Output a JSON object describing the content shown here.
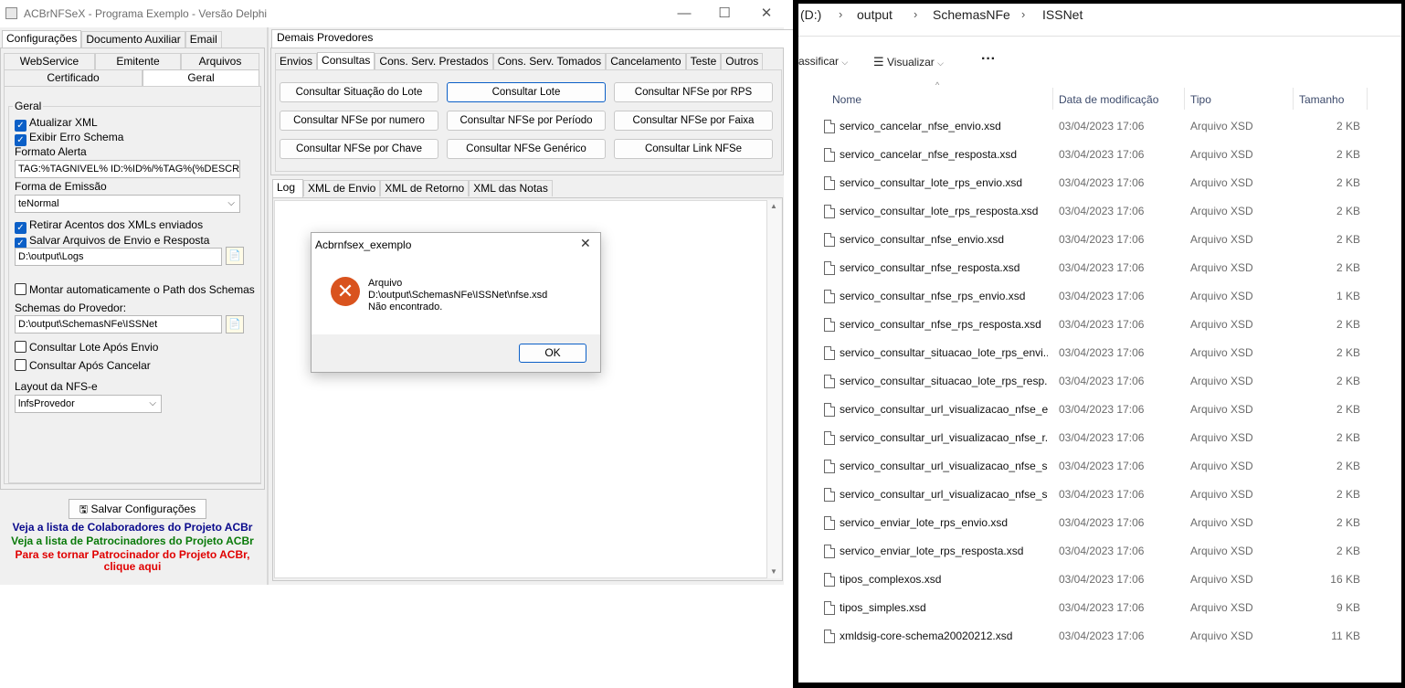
{
  "app": {
    "title": "ACBrNFSeX - Programa Exemplo - Versão Delphi",
    "window_controls": {
      "minimize": "—",
      "maximize": "☐",
      "close": "✕"
    },
    "left_tabs": [
      "Configurações",
      "Documento Auxiliar",
      "Email"
    ],
    "sub_tabs_row1": [
      "WebService",
      "Emitente",
      "Arquivos"
    ],
    "sub_tabs_row2": [
      "Certificado",
      "Geral"
    ],
    "geral": {
      "group_label": "Geral",
      "atualizar_xml": "Atualizar XML",
      "exibir_erro": "Exibir Erro Schema",
      "formato_alerta_label": "Formato Alerta",
      "formato_alerta_value": "TAG:%TAGNIVEL% ID:%ID%/%TAG%(%DESCRI",
      "forma_emissao_label": "Forma de Emissão",
      "forma_emissao_value": "teNormal",
      "retirar_acentos": "Retirar Acentos dos XMLs enviados",
      "salvar_arquivos": "Salvar Arquivos de Envio e Resposta",
      "logs_path": "D:\\output\\Logs",
      "montar_path": "Montar automaticamente o Path dos Schemas",
      "schemas_label": "Schemas do Provedor:",
      "schemas_path": "D:\\output\\SchemasNFe\\ISSNet",
      "consultar_lote": "Consultar Lote Após Envio",
      "consultar_cancelar": "Consultar Após Cancelar",
      "layout_label": "Layout da NFS-e",
      "layout_value": "lnfsProvedor"
    },
    "salvar_button": "Salvar Configurações",
    "links": {
      "colaboradores": "Veja a lista de Colaboradores do Projeto ACBr",
      "patrocinadores": "Veja a lista de Patrocinadores do Projeto ACBr",
      "patrocinador_line1": "Para se tornar Patrocinador do Projeto ACBr,",
      "patrocinador_line2": "clique aqui"
    },
    "right_top_tab": "Demais Provedores",
    "op_tabs": [
      "Envios",
      "Consultas",
      "Cons. Serv. Prestados",
      "Cons. Serv. Tomados",
      "Cancelamento",
      "Teste",
      "Outros"
    ],
    "consulta_buttons": [
      [
        "Consultar Situação do Lote",
        "Consultar Lote",
        "Consultar NFSe por RPS"
      ],
      [
        "Consultar NFSe por numero",
        "Consultar NFSe por Período",
        "Consultar NFSe por Faixa"
      ],
      [
        "Consultar NFSe por Chave",
        "Consultar NFSe Genérico",
        "Consultar Link NFSe"
      ]
    ],
    "log_tabs": [
      "Log",
      "XML de Envio",
      "XML de Retorno",
      "XML das Notas"
    ]
  },
  "dialog": {
    "title": "Acbrnfsex_exemplo",
    "line1": "Arquivo",
    "line2": "D:\\output\\SchemasNFe\\ISSNet\\nfse.xsd",
    "line3": "Não encontrado.",
    "ok": "OK",
    "close": "✕"
  },
  "explorer": {
    "breadcrumb": [
      "(D:)",
      "output",
      "SchemasNFe",
      "ISSNet"
    ],
    "toolbar": {
      "classificar": "assificar",
      "visualizar": "Visualizar",
      "more": "···"
    },
    "columns": {
      "name": "Nome",
      "date": "Data de modificação",
      "type": "Tipo",
      "size": "Tamanho"
    },
    "files": [
      {
        "name": "servico_cancelar_nfse_envio.xsd",
        "date": "03/04/2023 17:06",
        "type": "Arquivo XSD",
        "size": "2 KB"
      },
      {
        "name": "servico_cancelar_nfse_resposta.xsd",
        "date": "03/04/2023 17:06",
        "type": "Arquivo XSD",
        "size": "2 KB"
      },
      {
        "name": "servico_consultar_lote_rps_envio.xsd",
        "date": "03/04/2023 17:06",
        "type": "Arquivo XSD",
        "size": "2 KB"
      },
      {
        "name": "servico_consultar_lote_rps_resposta.xsd",
        "date": "03/04/2023 17:06",
        "type": "Arquivo XSD",
        "size": "2 KB"
      },
      {
        "name": "servico_consultar_nfse_envio.xsd",
        "date": "03/04/2023 17:06",
        "type": "Arquivo XSD",
        "size": "2 KB"
      },
      {
        "name": "servico_consultar_nfse_resposta.xsd",
        "date": "03/04/2023 17:06",
        "type": "Arquivo XSD",
        "size": "2 KB"
      },
      {
        "name": "servico_consultar_nfse_rps_envio.xsd",
        "date": "03/04/2023 17:06",
        "type": "Arquivo XSD",
        "size": "1 KB"
      },
      {
        "name": "servico_consultar_nfse_rps_resposta.xsd",
        "date": "03/04/2023 17:06",
        "type": "Arquivo XSD",
        "size": "2 KB"
      },
      {
        "name": "servico_consultar_situacao_lote_rps_envi...",
        "date": "03/04/2023 17:06",
        "type": "Arquivo XSD",
        "size": "2 KB"
      },
      {
        "name": "servico_consultar_situacao_lote_rps_resp...",
        "date": "03/04/2023 17:06",
        "type": "Arquivo XSD",
        "size": "2 KB"
      },
      {
        "name": "servico_consultar_url_visualizacao_nfse_e...",
        "date": "03/04/2023 17:06",
        "type": "Arquivo XSD",
        "size": "2 KB"
      },
      {
        "name": "servico_consultar_url_visualizacao_nfse_r...",
        "date": "03/04/2023 17:06",
        "type": "Arquivo XSD",
        "size": "2 KB"
      },
      {
        "name": "servico_consultar_url_visualizacao_nfse_s...",
        "date": "03/04/2023 17:06",
        "type": "Arquivo XSD",
        "size": "2 KB"
      },
      {
        "name": "servico_consultar_url_visualizacao_nfse_s...",
        "date": "03/04/2023 17:06",
        "type": "Arquivo XSD",
        "size": "2 KB"
      },
      {
        "name": "servico_enviar_lote_rps_envio.xsd",
        "date": "03/04/2023 17:06",
        "type": "Arquivo XSD",
        "size": "2 KB"
      },
      {
        "name": "servico_enviar_lote_rps_resposta.xsd",
        "date": "03/04/2023 17:06",
        "type": "Arquivo XSD",
        "size": "2 KB"
      },
      {
        "name": "tipos_complexos.xsd",
        "date": "03/04/2023 17:06",
        "type": "Arquivo XSD",
        "size": "16 KB"
      },
      {
        "name": "tipos_simples.xsd",
        "date": "03/04/2023 17:06",
        "type": "Arquivo XSD",
        "size": "9 KB"
      },
      {
        "name": "xmldsig-core-schema20020212.xsd",
        "date": "03/04/2023 17:06",
        "type": "Arquivo XSD",
        "size": "11 KB"
      }
    ]
  }
}
